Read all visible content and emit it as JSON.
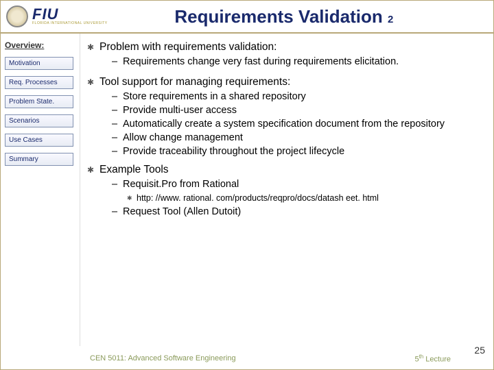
{
  "header": {
    "fiu": "FIU",
    "fiu_sub": "FLORIDA INTERNATIONAL UNIVERSITY",
    "title_main": "Requirements Validation",
    "title_sub": "2"
  },
  "sidebar": {
    "heading": "Overview:",
    "items": [
      "Motivation",
      "Req. Processes",
      "Problem State.",
      "Scenarios",
      "Use Cases",
      "Summary"
    ]
  },
  "content": {
    "b1": "Problem with requirements validation:",
    "b1_subs": [
      "Requirements change very fast during requirements elicitation."
    ],
    "b2": "Tool support for managing requirements:",
    "b2_subs": [
      "Store requirements  in a shared repository",
      "Provide multi-user access",
      "Automatically create a system specification document from the repository",
      "Allow change management",
      "Provide traceability throughout the project lifecycle"
    ],
    "b3": "Example Tools",
    "b3_subs": [
      " Requisit.Pro from Rational",
      " Request Tool (Allen Dutoit)"
    ],
    "b3_subsub": "http: //www. rational. com/products/reqpro/docs/datash eet. html"
  },
  "footer": {
    "left": "CEN 5011: Advanced Software Engineering",
    "mid_pre": "5",
    "mid_sup": "th",
    "mid_post": " Lecture",
    "page": "25"
  }
}
